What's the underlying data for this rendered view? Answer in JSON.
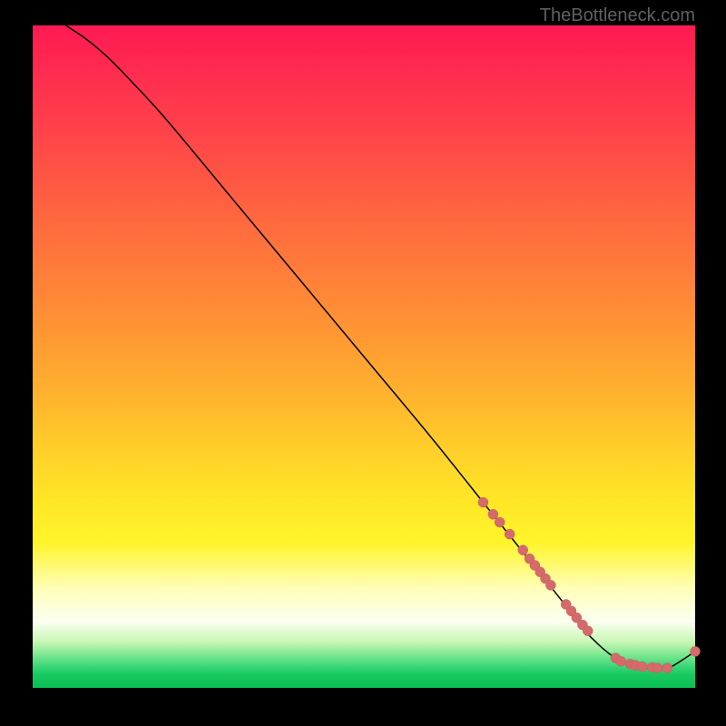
{
  "attribution": "TheBottleneck.com",
  "chart_data": {
    "type": "line",
    "title": "",
    "xlabel": "",
    "ylabel": "",
    "xlim": [
      0,
      100
    ],
    "ylim": [
      0,
      100
    ],
    "series": [
      {
        "name": "bottleneck-curve",
        "x": [
          5,
          8,
          11,
          14,
          20,
          30,
          40,
          50,
          60,
          68,
          72,
          76,
          80,
          83,
          86,
          88,
          90,
          92,
          94,
          96,
          100
        ],
        "y": [
          100,
          98,
          95.5,
          92.5,
          86,
          74,
          62,
          50,
          38,
          28,
          23,
          18,
          13,
          9,
          6,
          4.5,
          3.5,
          3,
          3,
          3,
          5.5
        ]
      }
    ],
    "markers": {
      "name": "data-points",
      "x": [
        68,
        69.5,
        70.5,
        72,
        74,
        75,
        75.8,
        76.6,
        77.4,
        78.2,
        80.5,
        81.3,
        82.1,
        83,
        83.8,
        88,
        88.8,
        90.2,
        91,
        92,
        93.5,
        94.3,
        95.8,
        100
      ],
      "y": [
        28,
        26.2,
        25,
        23.2,
        20.8,
        19.5,
        18.5,
        17.5,
        16.5,
        15.5,
        12.6,
        11.6,
        10.6,
        9.5,
        8.6,
        4.5,
        4.0,
        3.6,
        3.4,
        3.2,
        3.1,
        3.0,
        3.0,
        5.5
      ]
    }
  }
}
